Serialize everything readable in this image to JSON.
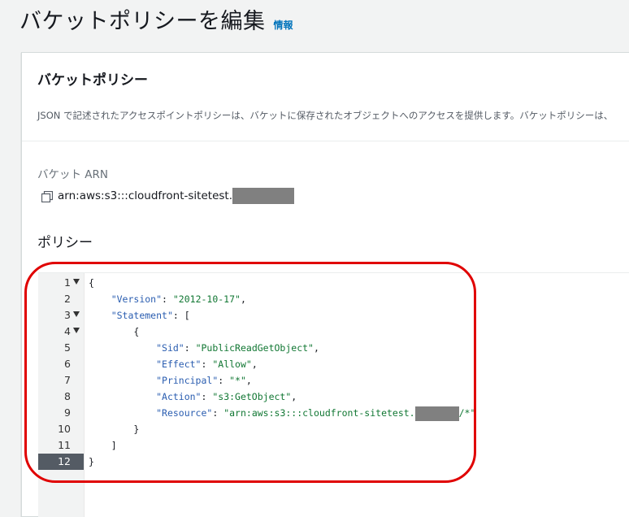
{
  "page": {
    "title": "バケットポリシーを編集",
    "info_link": "情報"
  },
  "panel": {
    "title": "バケットポリシー",
    "description": "JSON で記述されたアクセスポイントポリシーは、バケットに保存されたオブジェクトへのアクセスを提供します。バケットポリシーは、"
  },
  "arn": {
    "label": "バケット ARN",
    "value": "arn:aws:s3:::cloudfront-sitetest."
  },
  "policy": {
    "label": "ポリシー"
  },
  "editor": {
    "active_line": 12,
    "lines": [
      {
        "n": "1",
        "fold": true,
        "text": "{"
      },
      {
        "n": "2",
        "fold": false,
        "key": "\"Version\"",
        "sep": ": ",
        "val": "\"2012-10-17\"",
        "tail": ",",
        "indent": "    "
      },
      {
        "n": "3",
        "fold": true,
        "key": "\"Statement\"",
        "sep": ": ",
        "tail": "[",
        "indent": "    "
      },
      {
        "n": "4",
        "fold": true,
        "text": "        {"
      },
      {
        "n": "5",
        "fold": false,
        "key": "\"Sid\"",
        "sep": ": ",
        "val": "\"PublicReadGetObject\"",
        "tail": ",",
        "indent": "            "
      },
      {
        "n": "6",
        "fold": false,
        "key": "\"Effect\"",
        "sep": ": ",
        "val": "\"Allow\"",
        "tail": ",",
        "indent": "            "
      },
      {
        "n": "7",
        "fold": false,
        "key": "\"Principal\"",
        "sep": ": ",
        "val": "\"*\"",
        "tail": ",",
        "indent": "            "
      },
      {
        "n": "8",
        "fold": false,
        "key": "\"Action\"",
        "sep": ": ",
        "val": "\"s3:GetObject\"",
        "tail": ",",
        "indent": "            "
      },
      {
        "n": "9",
        "fold": false,
        "key": "\"Resource\"",
        "sep": ": ",
        "val": "\"arn:aws:s3:::cloudfront-sitetest.",
        "redact": true,
        "val2": "/*\"",
        "indent": "            "
      },
      {
        "n": "10",
        "fold": false,
        "text": "        }"
      },
      {
        "n": "11",
        "fold": false,
        "text": "    ]"
      },
      {
        "n": "12",
        "fold": false,
        "text": "}"
      }
    ]
  },
  "colors": {
    "highlight_ring": "#e00000",
    "info_link": "#0073bb",
    "json_key": "#2a5db0",
    "json_string": "#117733"
  }
}
